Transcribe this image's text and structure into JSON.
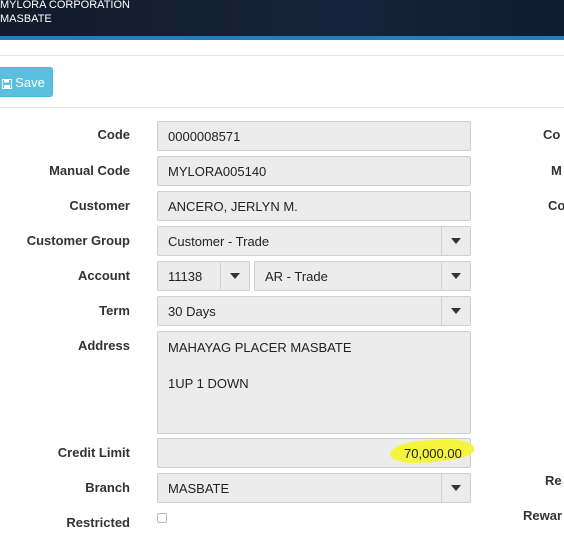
{
  "header": {
    "company_line1": "MYLORA CORPORATION",
    "company_line2": "MASBATE"
  },
  "toolbar": {
    "save_label": "Save",
    "save_icon": "floppy-disk-icon"
  },
  "form": {
    "code_label": "Code",
    "code_value": "0000008571",
    "manual_code_label": "Manual Code",
    "manual_code_value": "MYLORA005140",
    "customer_label": "Customer",
    "customer_value": "ANCERO, JERLYN M.",
    "customer_group_label": "Customer Group",
    "customer_group_value": "Customer - Trade",
    "account_label": "Account",
    "account_code_value": "11138",
    "account_name_value": "AR - Trade",
    "term_label": "Term",
    "term_value": "30 Days",
    "address_label": "Address",
    "address_line1": "MAHAYAG PLACER MASBATE",
    "address_line2": "",
    "address_line3": "1UP 1 DOWN",
    "credit_limit_label": "Credit Limit",
    "credit_limit_value": "70,000.00",
    "branch_label": "Branch",
    "branch_value": "MASBATE",
    "restricted_label": "Restricted",
    "restricted_checked": false
  },
  "right_column": {
    "label1": "Co",
    "label2": "M",
    "label3": "Co",
    "label4": "Re",
    "label5": "Rewar"
  },
  "colors": {
    "accent_blue": "#1f7fc1",
    "save_button": "#5bc0de",
    "highlight": "#f4f53c"
  }
}
